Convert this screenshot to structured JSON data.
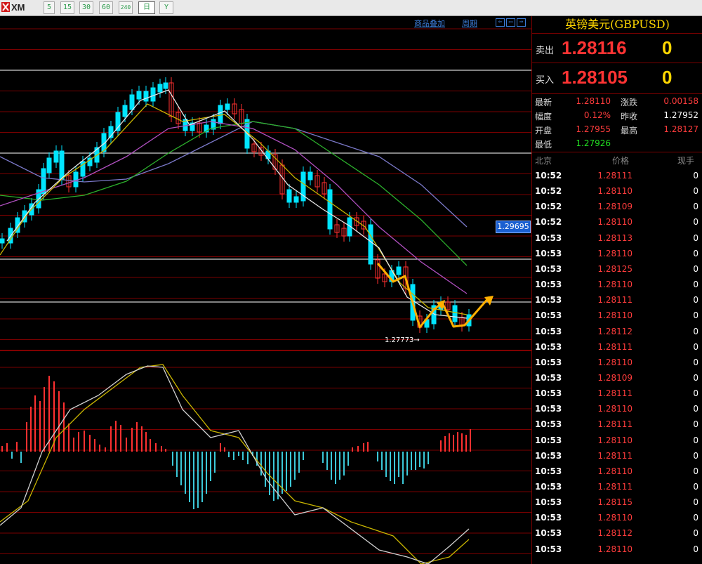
{
  "toolbar": {
    "logo_text": "XM",
    "timeframes": [
      "5",
      "15",
      "30",
      "60",
      "240",
      "日",
      "Y"
    ],
    "active_timeframe": "日"
  },
  "chart": {
    "links": [
      "商品叠加",
      "周期"
    ],
    "current_price_tag": "1.29695",
    "low_annotation": "1.27773",
    "colors": {
      "bull": "#00e5ff",
      "bear": "#ff3030",
      "ma_white": "#e6e6e6",
      "ma_yellow": "#c8b400",
      "ma_purple": "#b050c0",
      "ma_green": "#2cb02c",
      "ma_violet": "#7a78c8",
      "arrow": "#ffb000",
      "grid_red": "#7a0000"
    }
  },
  "panel": {
    "title": "英镑美元(GBPUSD)",
    "sell_label": "卖出",
    "sell_price": "1.28116",
    "sell_tail": "0",
    "buy_label": "买入",
    "buy_price": "1.28105",
    "buy_tail": "0",
    "stats": [
      {
        "label": "最新",
        "value": "1.28110",
        "label2": "涨跌",
        "value2": "0.00158"
      },
      {
        "label": "幅度",
        "value": "0.12%",
        "label2": "昨收",
        "value2": "1.27952"
      },
      {
        "label": "开盘",
        "value": "1.27955",
        "label2": "最高",
        "value2": "1.28127"
      },
      {
        "label": "最低",
        "value": "1.27926",
        "label2": "",
        "value2": ""
      }
    ],
    "tick_headers": [
      "北京",
      "价格",
      "现手"
    ],
    "ticks": [
      {
        "time": "10:52",
        "price": "1.28111",
        "vol": "0"
      },
      {
        "time": "10:52",
        "price": "1.28110",
        "vol": "0"
      },
      {
        "time": "10:52",
        "price": "1.28109",
        "vol": "0"
      },
      {
        "time": "10:52",
        "price": "1.28110",
        "vol": "0"
      },
      {
        "time": "10:53",
        "price": "1.28113",
        "vol": "0"
      },
      {
        "time": "10:53",
        "price": "1.28110",
        "vol": "0"
      },
      {
        "time": "10:53",
        "price": "1.28125",
        "vol": "0"
      },
      {
        "time": "10:53",
        "price": "1.28110",
        "vol": "0"
      },
      {
        "time": "10:53",
        "price": "1.28111",
        "vol": "0"
      },
      {
        "time": "10:53",
        "price": "1.28110",
        "vol": "0"
      },
      {
        "time": "10:53",
        "price": "1.28112",
        "vol": "0"
      },
      {
        "time": "10:53",
        "price": "1.28111",
        "vol": "0"
      },
      {
        "time": "10:53",
        "price": "1.28110",
        "vol": "0"
      },
      {
        "time": "10:53",
        "price": "1.28109",
        "vol": "0"
      },
      {
        "time": "10:53",
        "price": "1.28111",
        "vol": "0"
      },
      {
        "time": "10:53",
        "price": "1.28110",
        "vol": "0"
      },
      {
        "time": "10:53",
        "price": "1.28111",
        "vol": "0"
      },
      {
        "time": "10:53",
        "price": "1.28110",
        "vol": "0"
      },
      {
        "time": "10:53",
        "price": "1.28111",
        "vol": "0"
      },
      {
        "time": "10:53",
        "price": "1.28110",
        "vol": "0"
      },
      {
        "time": "10:53",
        "price": "1.28111",
        "vol": "0"
      },
      {
        "time": "10:53",
        "price": "1.28115",
        "vol": "0"
      },
      {
        "time": "10:53",
        "price": "1.28110",
        "vol": "0"
      },
      {
        "time": "10:53",
        "price": "1.28112",
        "vol": "0"
      },
      {
        "time": "10:53",
        "price": "1.28110",
        "vol": "0"
      }
    ]
  }
}
